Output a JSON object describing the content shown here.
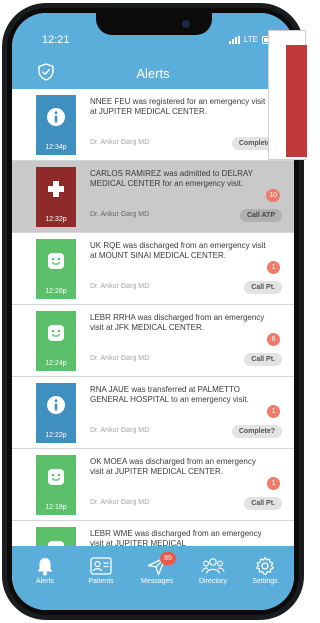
{
  "status_bar": {
    "time": "12:21",
    "carrier": "LTE"
  },
  "header": {
    "title": "Alerts"
  },
  "alerts": [
    {
      "message": "NNEE FEU was registered for an emergency visit at JUPITER MEDICAL CENTER.",
      "time": "12:34p",
      "doctor": "Dr. Ankur Garg MD",
      "action": "Complete?",
      "badge": "",
      "type": "info",
      "color": "#3f8fbf",
      "active": false
    },
    {
      "message": "CARLOS RAMIREZ was admitted to DELRAY MEDICAL CENTER for an emergency visit.",
      "time": "12:32p",
      "doctor": "Dr. Ankur Garg MD",
      "action": "Call ATP",
      "badge": "10",
      "type": "cross",
      "color": "#8e2a2a",
      "active": true
    },
    {
      "message": "UK RQE was discharged from an emergency visit at MOUNT SINAI MEDICAL CENTER.",
      "time": "12:26p",
      "doctor": "Dr. Ankur Garg MD",
      "action": "Call Pt.",
      "badge": "1",
      "type": "smile",
      "color": "#5cbf6a",
      "active": false
    },
    {
      "message": "LEBR RRHA was discharged from an emergency visit at JFK MEDICAL CENTER.",
      "time": "12:24p",
      "doctor": "Dr. Ankur Garg MD",
      "action": "Call Pt.",
      "badge": "6",
      "type": "smile",
      "color": "#5cbf6a",
      "active": false
    },
    {
      "message": "RNA JAUE was transferred at PALMETTO GENERAL HOSPITAL to an emergency visit.",
      "time": "12:22p",
      "doctor": "Dr. Ankur Garg MD",
      "action": "Complete?",
      "badge": "1",
      "type": "info",
      "color": "#3f8fbf",
      "active": false
    },
    {
      "message": "OK MOEA was discharged from an emergency visit at JUPITER MEDICAL CENTER.",
      "time": "12:18p",
      "doctor": "Dr. Ankur Garg MD",
      "action": "Call Pt.",
      "badge": "1",
      "type": "smile",
      "color": "#5cbf6a",
      "active": false
    },
    {
      "message": "LEBR WME was discharged from an emergency visit at JUPITER MEDICAL",
      "time": "",
      "doctor": "",
      "action": "",
      "badge": "",
      "type": "smile",
      "color": "#5cbf6a",
      "active": false
    }
  ],
  "tabbar": {
    "alerts": "Alerts",
    "patients": "Patients",
    "messages": "Messages",
    "messages_badge": "89",
    "directory": "Directory",
    "settings": "Settings"
  }
}
